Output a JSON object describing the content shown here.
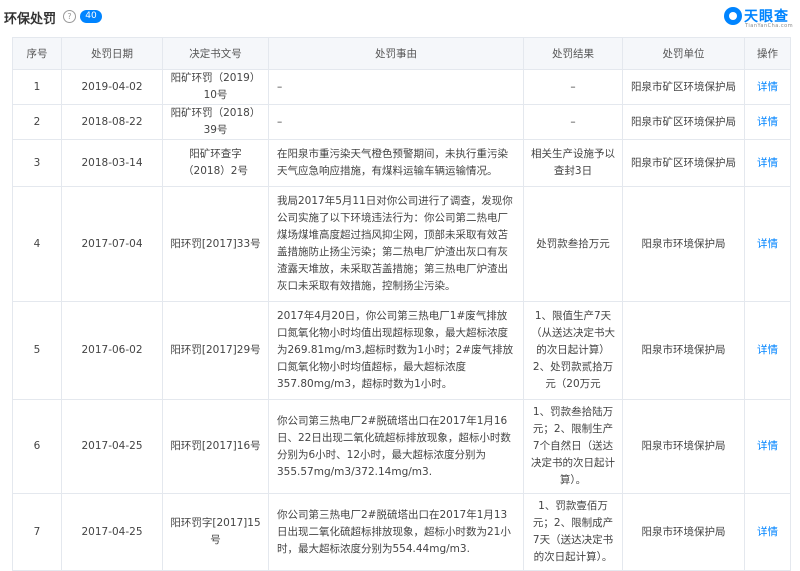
{
  "header": {
    "title": "环保处罚",
    "count": "40",
    "logo_text": "天眼查",
    "logo_sub": "TianYanCha.com",
    "accent": "#0084ff"
  },
  "table": {
    "columns": [
      "序号",
      "处罚日期",
      "决定书文号",
      "处罚事由",
      "处罚结果",
      "处罚单位",
      "操作"
    ],
    "rows": [
      {
        "no": "1",
        "date": "2019-04-02",
        "doc": "阳矿环罚（2019）10号",
        "reason": "–",
        "result": "–",
        "unit": "阳泉市矿区环境保护局",
        "action": "详情"
      },
      {
        "no": "2",
        "date": "2018-08-22",
        "doc": "阳矿环罚（2018）39号",
        "reason": "–",
        "result": "–",
        "unit": "阳泉市矿区环境保护局",
        "action": "详情"
      },
      {
        "no": "3",
        "date": "2018-03-14",
        "doc": "阳矿环查字（2018）2号",
        "reason": "在阳泉市重污染天气橙色预警期间，未执行重污染天气应急响应措施，有煤料运输车辆运输情况。",
        "result": "相关生产设施予以查封3日",
        "unit": "阳泉市矿区环境保护局",
        "action": "详情"
      },
      {
        "no": "4",
        "date": "2017-07-04",
        "doc": "阳环罚[2017]33号",
        "reason": "我局2017年5月11日对你公司进行了调查，发现你公司实施了以下环境违法行为：你公司第二热电厂煤场煤堆高度超过挡风抑尘网，顶部未采取有效苫盖措施防止扬尘污染；第二热电厂炉渣出灰口有灰渣露天堆放，未采取苫盖措施；第三热电厂炉渣出灰口未采取有效措施，控制扬尘污染。",
        "result": "处罚款叁拾万元",
        "unit": "阳泉市环境保护局",
        "action": "详情"
      },
      {
        "no": "5",
        "date": "2017-06-02",
        "doc": "阳环罚[2017]29号",
        "reason": "2017年4月20日，你公司第三热电厂1#废气排放口氮氧化物小时均值出现超标现象，最大超标浓度为269.81mg/m3,超标时数为1小时；2#废气排放口氮氧化物小时均值超标，最大超标浓度357.80mg/m3，超标时数为1小时。",
        "result": "1、限值生产7天（从送达决定书大的次日起计算）2、处罚款贰拾万元（20万元",
        "unit": "阳泉市环境保护局",
        "action": "详情"
      },
      {
        "no": "6",
        "date": "2017-04-25",
        "doc": "阳环罚[2017]16号",
        "reason": "你公司第三热电厂2#脱硫塔出口在2017年1月16日、22日出现二氧化硫超标排放现象，超标小时数分别为6小时、12小时，最大超标浓度分别为355.57mg/m3/372.14mg/m3.",
        "result": "1、罚款叁拾陆万元；2、限制生产7个自然日（送达决定书的次日起计算）。",
        "unit": "阳泉市环境保护局",
        "action": "详情"
      },
      {
        "no": "7",
        "date": "2017-04-25",
        "doc": "阳环罚字[2017]15号",
        "reason": "你公司第三热电厂2#脱硫塔出口在2017年1月13日出现二氧化硫超标排放现象，超标小时数为21小时，最大超标浓度分别为554.44mg/m3.",
        "result": "1、罚款壹佰万元；2、限制成产7天（送达决定书的次日起计算）。",
        "unit": "阳泉市环境保护局",
        "action": "详情"
      }
    ]
  }
}
